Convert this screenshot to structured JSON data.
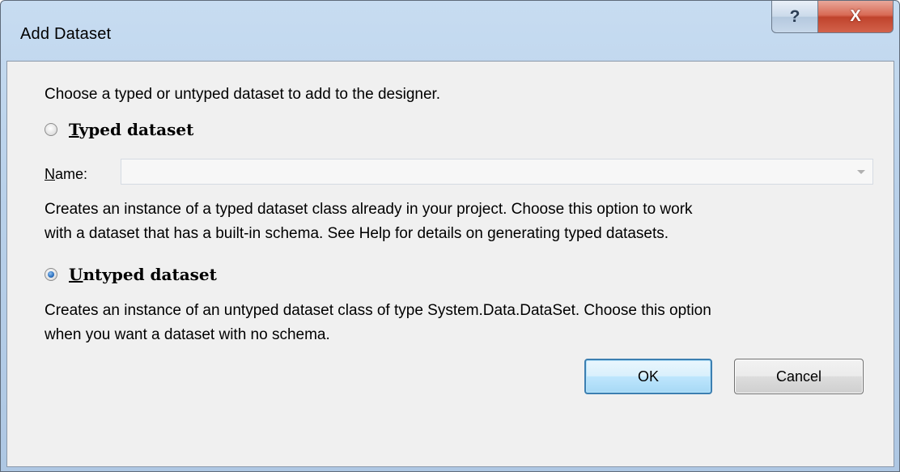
{
  "window": {
    "title": "Add Dataset",
    "help_glyph": "?",
    "close_glyph": "X"
  },
  "dialog": {
    "intro": "Choose a typed or untyped dataset to add to the designer.",
    "typed": {
      "label_access": "T",
      "label_rest": "yped dataset",
      "selected": false,
      "name_label_access": "N",
      "name_label_rest": "ame:",
      "name_value": "",
      "description_line1": "Creates an instance of a typed dataset class already in your project. Choose this option to work",
      "description_line2": "with a dataset that has a built-in schema. See Help for details on generating typed datasets."
    },
    "untyped": {
      "label_access": "U",
      "label_rest": "ntyped dataset",
      "selected": true,
      "description_line1": "Creates an instance of an untyped dataset class of type System.Data.DataSet. Choose this option",
      "description_line2": "when you want a dataset with no schema."
    }
  },
  "buttons": {
    "ok_label": "OK",
    "cancel_label": "Cancel"
  },
  "icons": {
    "help": "help-icon",
    "close": "close-icon",
    "dropdown": "chevron-down-icon"
  }
}
